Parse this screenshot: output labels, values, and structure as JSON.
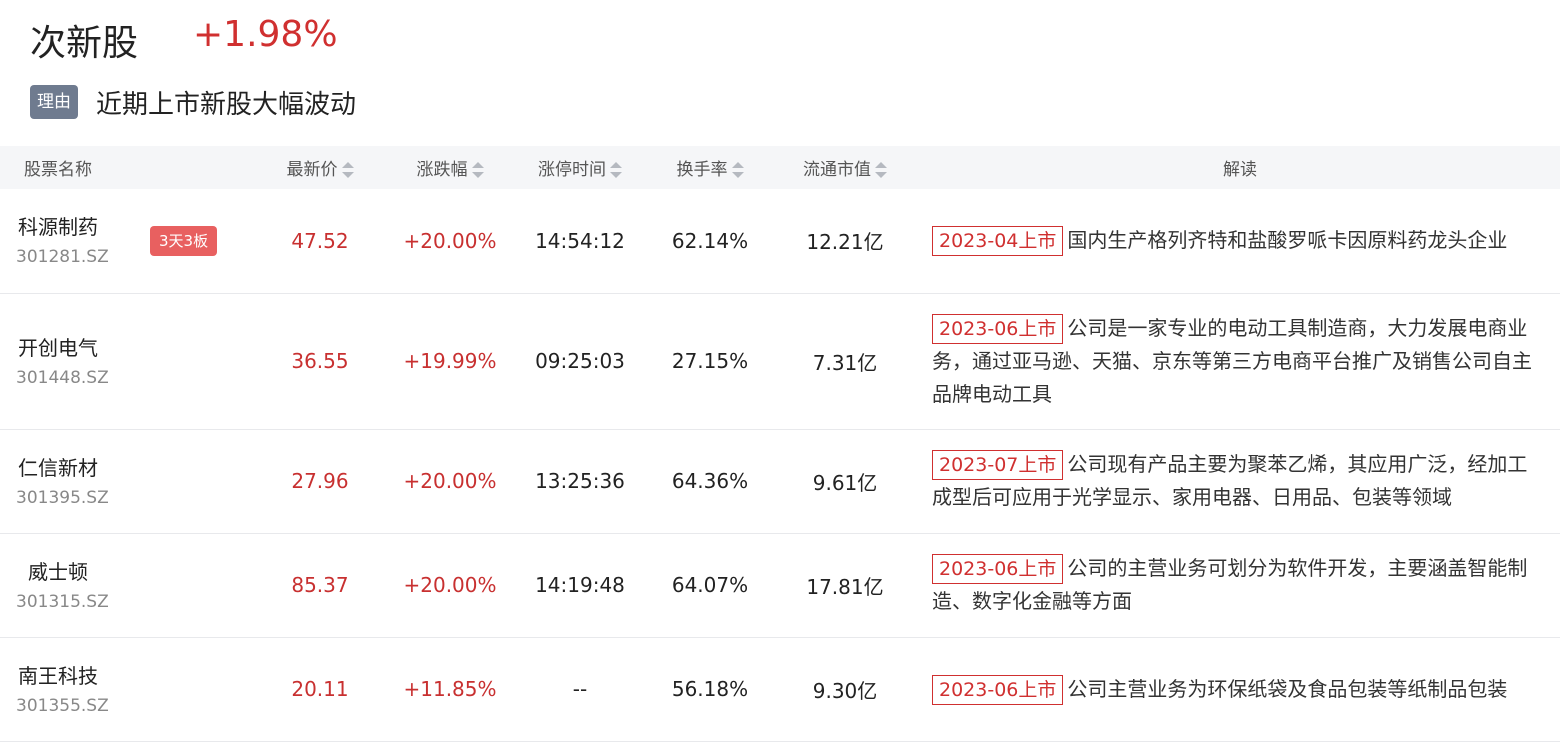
{
  "header": {
    "title": "次新股",
    "change": "+1.98%",
    "reason_label": "理由",
    "reason_text": "近期上市新股大幅波动"
  },
  "table": {
    "columns": {
      "name": "股票名称",
      "price": "最新价",
      "pct": "涨跌幅",
      "limit_time": "涨停时间",
      "turnover": "换手率",
      "mcap": "流通市值",
      "desc": "解读"
    },
    "rows": [
      {
        "name": "科源制药",
        "code": "301281.SZ",
        "badge": "3天3板",
        "price": "47.52",
        "pct": "+20.00%",
        "time": "14:54:12",
        "turnover": "62.14%",
        "mcap": "12.21亿",
        "date": "2023-04上市",
        "desc": "国内生产格列齐特和盐酸罗哌卡因原料药龙头企业"
      },
      {
        "name": "开创电气",
        "code": "301448.SZ",
        "badge": "",
        "price": "36.55",
        "pct": "+19.99%",
        "time": "09:25:03",
        "turnover": "27.15%",
        "mcap": "7.31亿",
        "date": "2023-06上市",
        "desc": "公司是一家专业的电动工具制造商，大力发展电商业务，通过亚马逊、天猫、京东等第三方电商平台推广及销售公司自主品牌电动工具"
      },
      {
        "name": "仁信新材",
        "code": "301395.SZ",
        "badge": "",
        "price": "27.96",
        "pct": "+20.00%",
        "time": "13:25:36",
        "turnover": "64.36%",
        "mcap": "9.61亿",
        "date": "2023-07上市",
        "desc": "公司现有产品主要为聚苯乙烯，其应用广泛，经加工成型后可应用于光学显示、家用电器、日用品、包装等领域"
      },
      {
        "name": "威士顿",
        "code": "301315.SZ",
        "badge": "",
        "price": "85.37",
        "pct": "+20.00%",
        "time": "14:19:48",
        "turnover": "64.07%",
        "mcap": "17.81亿",
        "date": "2023-06上市",
        "desc": "公司的主营业务可划分为软件开发，主要涵盖智能制造、数字化金融等方面"
      },
      {
        "name": "南王科技",
        "code": "301355.SZ",
        "badge": "",
        "price": "20.11",
        "pct": "+11.85%",
        "time": "--",
        "turnover": "56.18%",
        "mcap": "9.30亿",
        "date": "2023-06上市",
        "desc": "公司主营业务为环保纸袋及食品包装等纸制品包装"
      }
    ]
  },
  "colors": {
    "up": "#c83030",
    "badge": "#e86060",
    "tag": "#6f7b8f"
  }
}
